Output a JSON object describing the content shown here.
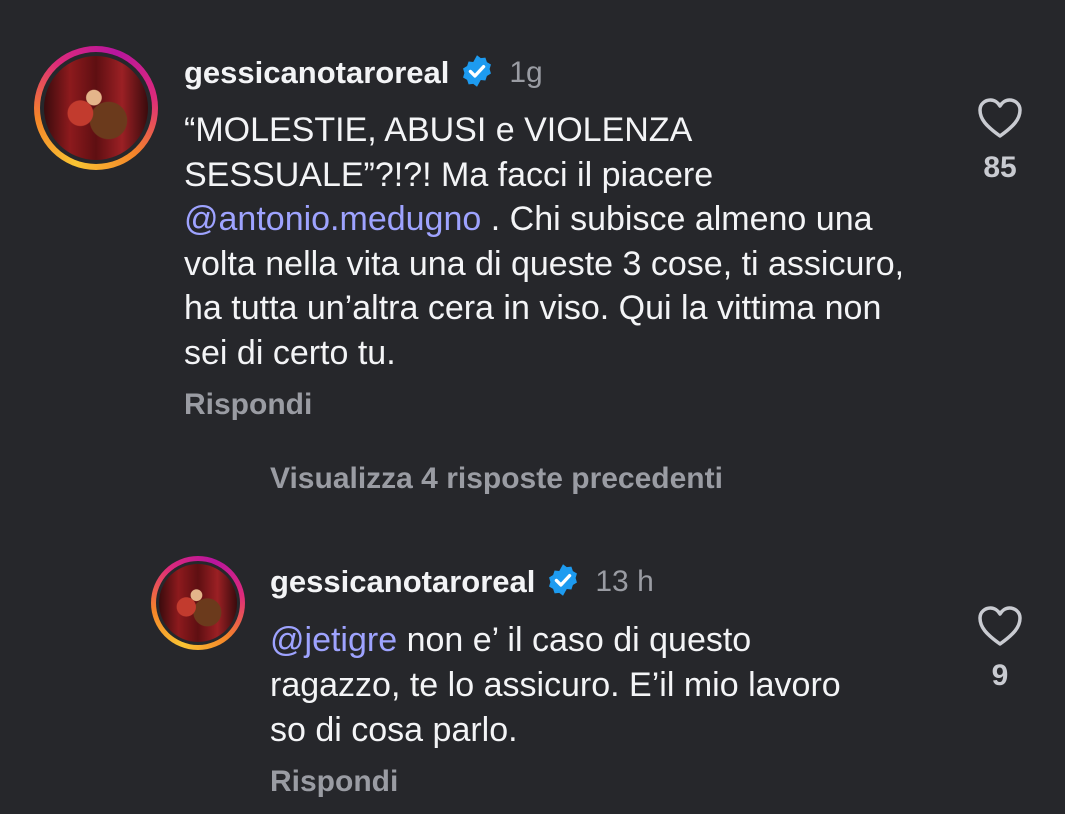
{
  "comments": [
    {
      "username": "gessicanotaroreal",
      "time": "1g",
      "text_part1": "“MOLESTIE, ABUSI e VIOLENZA SESSUALE”?!?! Ma facci il piacere ",
      "mention": "@antonio.medugno",
      "text_part2": " . Chi subisce almeno una volta nella vita una di queste 3 cose, ti assicuro, ha tutta un’altra cera in viso. Qui la vittima non sei di certo tu.",
      "reply_label": "Rispondi",
      "likes": "85"
    },
    {
      "username": "gessicanotaroreal",
      "time": "13 h",
      "mention": "@jetigre",
      "text_part2": " non e’ il caso di questo ragazzo, te lo assicuro. E’il mio lavoro so di cosa parlo.",
      "reply_label": "Rispondi",
      "likes": "9"
    }
  ],
  "view_more_label": "Visualizza 4 risposte precedenti",
  "icons": {
    "verified": "verified-badge-icon",
    "like": "heart-icon"
  },
  "colors": {
    "background": "#26272b",
    "mention": "#9ea3ff",
    "verified": "#1d9bf0",
    "muted": "#9a9ca3"
  }
}
